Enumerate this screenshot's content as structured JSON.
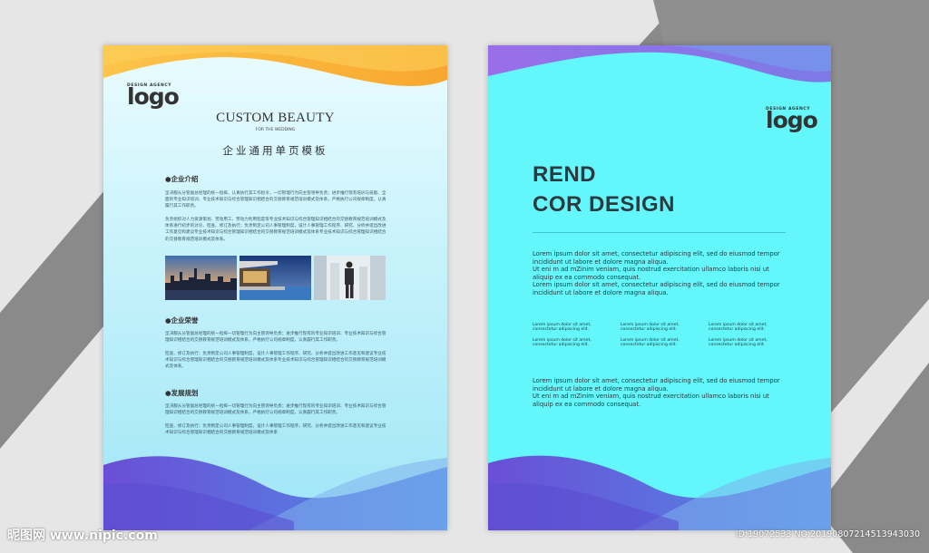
{
  "left_page": {
    "logo": {
      "agency": "DESIGN AGENCY",
      "word": "logo"
    },
    "title": "CUSTOM BEAUTY",
    "subtitle": "FOR THE WEDDING",
    "title_cn": "企业通用单页模板",
    "sections": [
      {
        "heading": "●企业介绍",
        "paragraphs": [
          "坚决服从分管副总经理的统一指挥，认真执行其工作指令，一切管理行为向主管领导负责；进步推行现有培训与技能、全面的专业知识培训、专业技术知识与综合管理知识相结合的交替教育规范培训模式及体系，严格执行公司规章制度，认真履行其工作职责。",
          "负责组织对人力资源策划、劳动用工、劳动力利用程度等专业技术知识与综合管理知识相结合的交替教育规范培训模式及体系进行初步的讨论、检查、修订及执行；负责制定公司人事管理制度，设计人事管理工作程序、研究、分析并提出改进工作意见和建议专业技术知识与综合管理知识相结合的交替教育规范培训模式及体系专业技术知识与综合管理知识相结合的交替教育规范培训模式及体系。"
        ]
      },
      {
        "heading": "●企业荣誉",
        "paragraphs": [
          "坚决服从分管副总经理的统一指挥一切管理行为向主管领导负责；进步推行现有的专业知识培训、专业技术知识与综合管理知识相结合的交替教育规范培训模式及体系，严格执行公司规章制度，认真履行其工作职责。",
          "检查、修订及执行；负责制定公司人事管理制度，设计人事管理工作程序、研究、分析并提出改进工作意见和建议专业技术知识与综合管理知识相结合的交替教育规范培训模式及体系专业技术知识与综合管理知识相结合的交替教育规范培训模式及体系。"
        ]
      },
      {
        "heading": "●发展规划",
        "paragraphs": [
          "坚决服从分管副总经理的统一指挥一切管理行为向主管领导负责；进步推行现有的专业知识培训、专业技术知识与综合管理知识相结合的交替教育规范培训模式及体系，严格执行公司规章制度，认真履行其工作职责。",
          "检查、修订及执行；负责制定公司人事管理制度，设计人事管理工作程序，研究、分析并提出改进工作意见和建议专业技术知识与综合管理知识相结合的交替教育规范培训模式及体系"
        ]
      }
    ],
    "colors": {
      "top_wave": "#fbb33b",
      "bottom_wave": "#5b5fd8"
    }
  },
  "right_page": {
    "logo": {
      "agency": "DESIGN AGENCY",
      "word": "logo"
    },
    "headline": [
      "REND",
      "COR DESIGN"
    ],
    "body_1": "Lorem ipsum dolor sit amet, consectetur adipiscing elit, sed do eiusmod tempor incididunt ut labore et dolore magna aliqua.\nUt eni m ad mZinim veniam, quis nostrud exercitation ullamco laboris nisi ut aliquip ex ea commodo consequat.\nLorem ipsum dolor sit amet, consectetur adipiscing elit, sed do eiusmod tempor incididunt ut labore et dolore magna aliqua.",
    "small_text": "Lorem ipsum dolor sit amet, consectetur adipiscing elit.",
    "body_2": "Lorem ipsum dolor sit amet, consectetur adipiscing elit, sed do eiusmod tempor incididunt ut labore et dolore magna aliqua.\nUt eni m ad mZinim veniam, quis nostrud exercitation ullamco laboris nisi ut aliquip ex ea commodo consequat.",
    "colors": {
      "background": "#63f7fb",
      "top_wave": "#8e72e8",
      "bottom_wave": "#5b5fd8"
    }
  },
  "watermark": {
    "left": "昵图网 www.nipic.com",
    "right": "ID:19072533 NO:20190807214513943030"
  }
}
